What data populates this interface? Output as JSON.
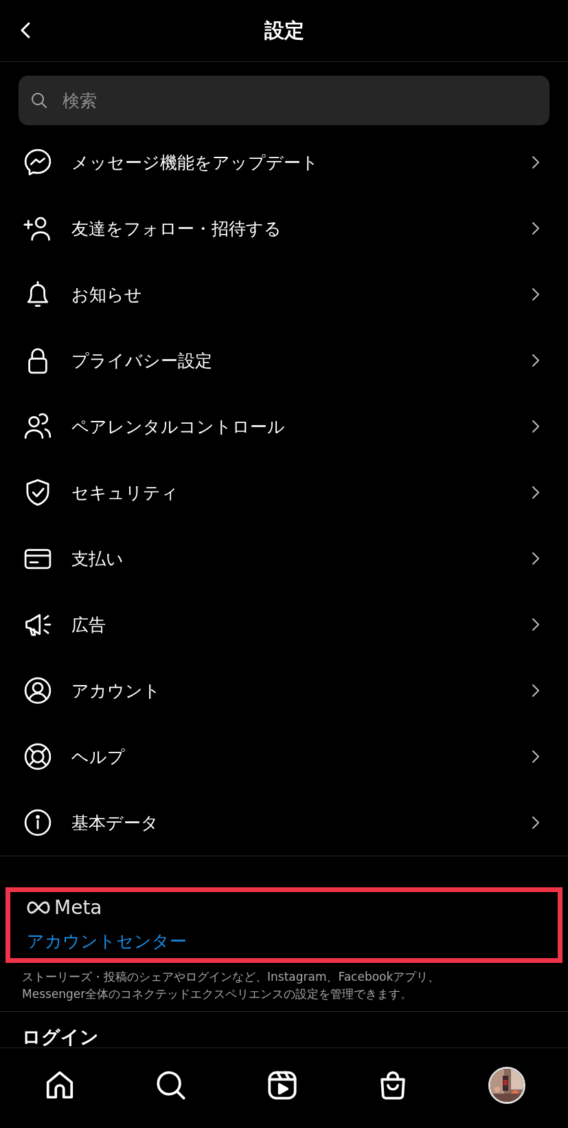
{
  "header": {
    "title": "設定"
  },
  "search": {
    "placeholder": "検索"
  },
  "menu_items": [
    {
      "label": "メッセージ機能をアップデート"
    },
    {
      "label": "友達をフォロー・招待する"
    },
    {
      "label": "お知らせ"
    },
    {
      "label": "プライバシー設定"
    },
    {
      "label": "ペアレンタルコントロール"
    },
    {
      "label": "セキュリティ"
    },
    {
      "label": "支払い"
    },
    {
      "label": "広告"
    },
    {
      "label": "アカウント"
    },
    {
      "label": "ヘルプ"
    },
    {
      "label": "基本データ"
    }
  ],
  "meta_section": {
    "logo_text": "Meta",
    "link": "アカウントセンター",
    "description": "ストーリーズ・投稿のシェアやログインなど、Instagram、Facebookアプリ、Messenger全体のコネクテッドエクスペリエンスの設定を管理できます。"
  },
  "next_section": {
    "title": "ログイン"
  },
  "tab_bar": [
    {
      "kind": "home"
    },
    {
      "kind": "search"
    },
    {
      "kind": "reels"
    },
    {
      "kind": "shop"
    },
    {
      "kind": "profile"
    }
  ]
}
